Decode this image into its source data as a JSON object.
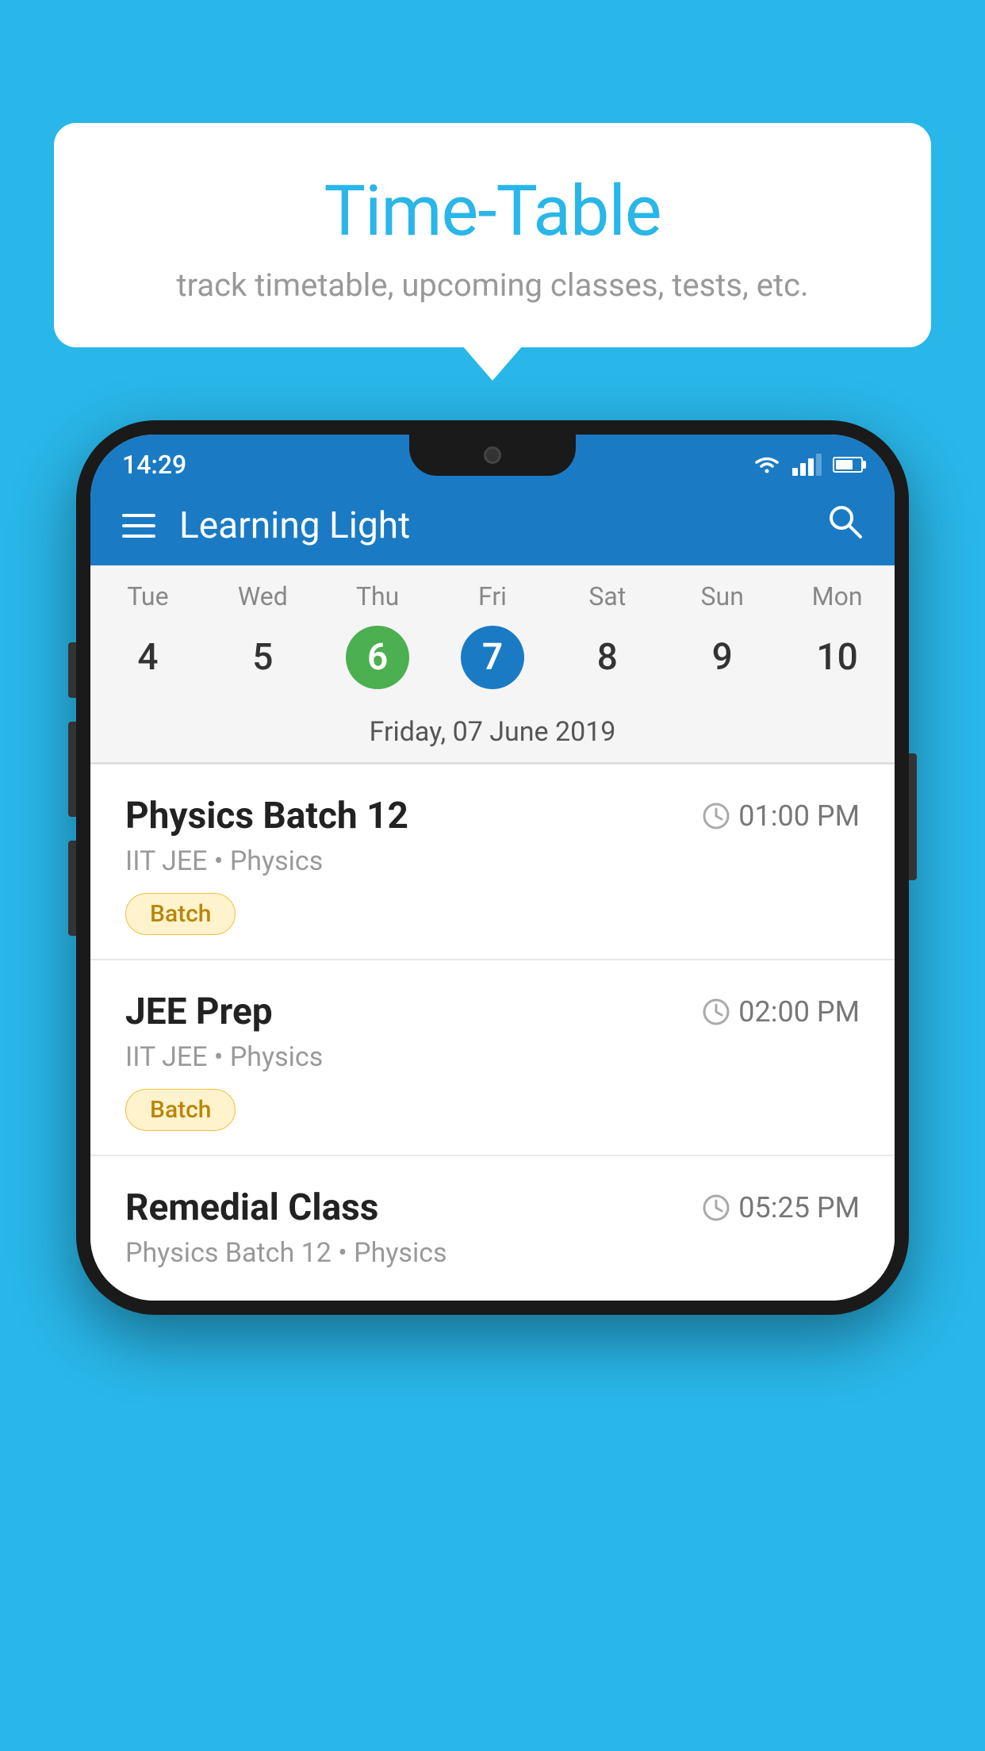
{
  "background_color": "#29b6e8",
  "bubble": {
    "title": "Time-Table",
    "subtitle": "track timetable, upcoming classes, tests, etc."
  },
  "phone": {
    "status_bar": {
      "time": "14:29",
      "wifi": "▾",
      "battery_pct": 70
    },
    "app_bar": {
      "title": "Learning Light",
      "menu_icon": "hamburger",
      "search_icon": "search"
    },
    "calendar": {
      "day_names": [
        "Tue",
        "Wed",
        "Thu",
        "Fri",
        "Sat",
        "Sun",
        "Mon"
      ],
      "day_numbers": [
        "4",
        "5",
        "6",
        "7",
        "8",
        "9",
        "10"
      ],
      "today_index": 2,
      "selected_index": 3,
      "selected_date_label": "Friday, 07 June 2019"
    },
    "schedule": [
      {
        "title": "Physics Batch 12",
        "time": "01:00 PM",
        "meta": "IIT JEE • Physics",
        "badge": "Batch"
      },
      {
        "title": "JEE Prep",
        "time": "02:00 PM",
        "meta": "IIT JEE • Physics",
        "badge": "Batch"
      },
      {
        "title": "Remedial Class",
        "time": "05:25 PM",
        "meta": "Physics Batch 12 • Physics",
        "badge": null
      }
    ]
  }
}
